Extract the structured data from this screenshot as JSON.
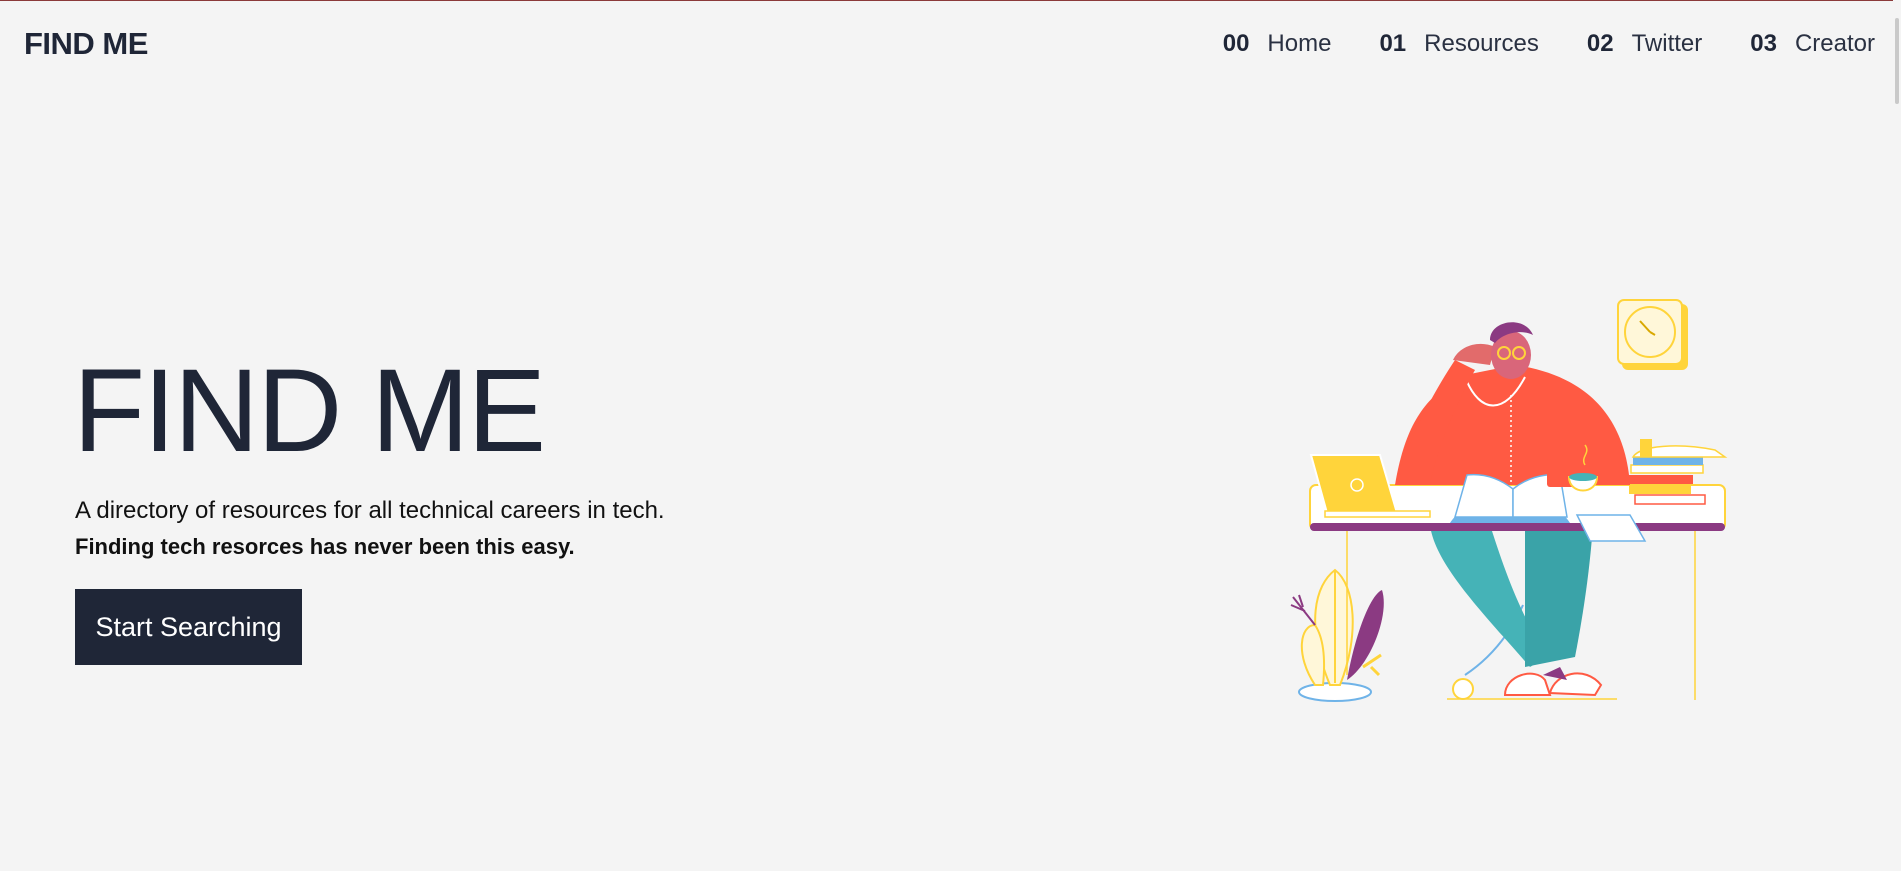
{
  "header": {
    "logo": "FIND ME",
    "nav": [
      {
        "num": "00",
        "label": "Home"
      },
      {
        "num": "01",
        "label": "Resources"
      },
      {
        "num": "02",
        "label": "Twitter"
      },
      {
        "num": "03",
        "label": "Creator"
      }
    ]
  },
  "hero": {
    "title": "FIND ME",
    "subtitle": "A directory of resources for all technical careers in tech.",
    "subtitle_bold": "Finding tech resorces has never been this easy.",
    "cta_label": "Start Searching"
  },
  "colors": {
    "background": "#f4f4f4",
    "primary": "#1f2637",
    "accent_red": "#ff5a43",
    "accent_yellow": "#ffd43b",
    "accent_teal": "#3aabb0",
    "accent_purple": "#8b3a82",
    "accent_blue": "#6fb3e8"
  },
  "illustration": {
    "icon": "person-at-desk-illustration"
  }
}
